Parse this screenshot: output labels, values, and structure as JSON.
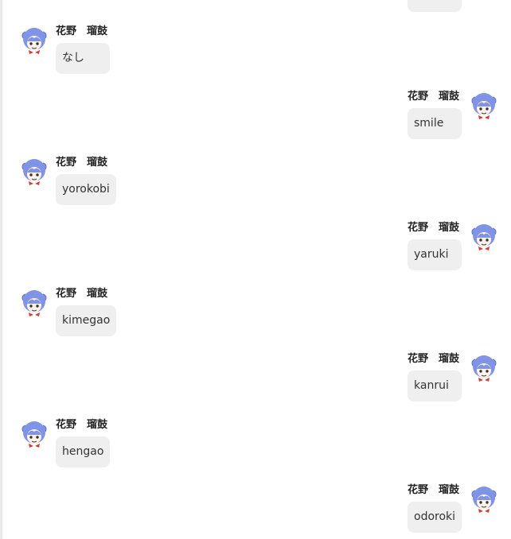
{
  "colors": {
    "bubble": "#efefef",
    "name_text": "#222222",
    "message_text": "#333333",
    "avatar_hair": "#7f94e6",
    "avatar_skin": "#fff3ea",
    "avatar_ribbon": "#d93a2f"
  },
  "messages": [
    {
      "side": "left",
      "name": "花野　瑠鼓",
      "text": "なし",
      "avatar_icon": "character-avatar-icon"
    },
    {
      "side": "right",
      "name": "花野　瑠鼓",
      "text": "smile",
      "avatar_icon": "character-avatar-icon"
    },
    {
      "side": "left",
      "name": "花野　瑠鼓",
      "text": "yorokobi",
      "avatar_icon": "character-avatar-icon"
    },
    {
      "side": "right",
      "name": "花野　瑠鼓",
      "text": "yaruki",
      "avatar_icon": "character-avatar-icon"
    },
    {
      "side": "left",
      "name": "花野　瑠鼓",
      "text": "kimegao",
      "avatar_icon": "character-avatar-icon"
    },
    {
      "side": "right",
      "name": "花野　瑠鼓",
      "text": "kanrui",
      "avatar_icon": "character-avatar-icon"
    },
    {
      "side": "left",
      "name": "花野　瑠鼓",
      "text": "hengao",
      "avatar_icon": "character-avatar-icon"
    },
    {
      "side": "right",
      "name": "花野　瑠鼓",
      "text": "odoroki",
      "avatar_icon": "character-avatar-icon"
    }
  ]
}
